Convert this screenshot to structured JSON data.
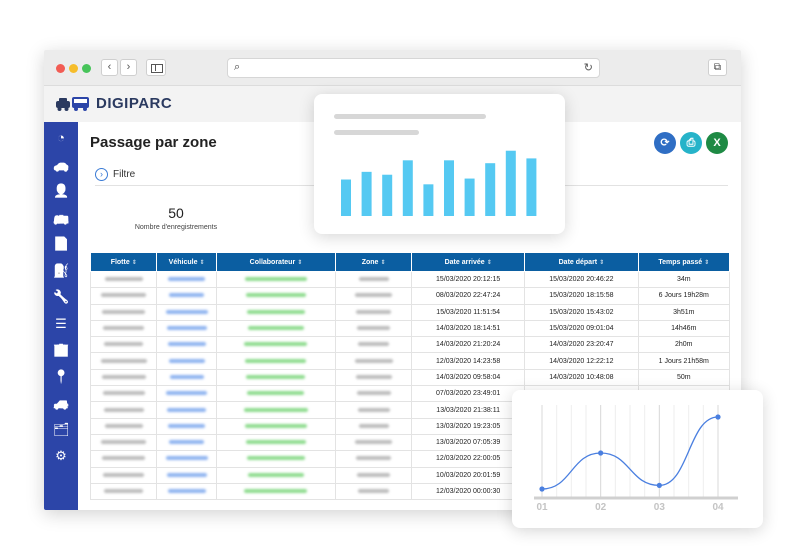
{
  "app": {
    "name": "DIGIPARC",
    "url_value": "",
    "page_title": "Passage par zone",
    "filter_label": "Filtre",
    "record_count": "50",
    "record_label": "Nombre d'enregistrements"
  },
  "colors": {
    "sidebar": "#2c45a8",
    "table_header": "#0b5ea1",
    "refresh_button": "#2f6ec4",
    "print_button": "#26b3c9",
    "excel_button": "#1e8a44",
    "bar_color": "#55c9f2",
    "line_color": "#4a7fe0"
  },
  "actions": [
    {
      "icon": "refresh-icon",
      "glyph": "⟳"
    },
    {
      "icon": "print-icon",
      "glyph": "⎙"
    },
    {
      "icon": "excel-icon",
      "glyph": "X"
    }
  ],
  "sidebar_icons": [
    {
      "icon": "dashboard-icon",
      "glyph": "◔"
    },
    {
      "icon": "car-icon",
      "glyph": "🚗"
    },
    {
      "icon": "user-icon",
      "glyph": "👤"
    },
    {
      "icon": "bus-icon",
      "glyph": "🚌"
    },
    {
      "icon": "document-icon",
      "glyph": "📄"
    },
    {
      "icon": "fuel-icon",
      "glyph": "⛽"
    },
    {
      "icon": "wrench-icon",
      "glyph": "🔧"
    },
    {
      "icon": "layers-icon",
      "glyph": "☰"
    },
    {
      "icon": "building-icon",
      "glyph": "🏢"
    },
    {
      "icon": "location-pin-icon",
      "glyph": "📍"
    },
    {
      "icon": "vehicle-front-icon",
      "glyph": "🚙"
    },
    {
      "icon": "files-icon",
      "glyph": "🗂"
    },
    {
      "icon": "gear-icon",
      "glyph": "⚙"
    }
  ],
  "table": {
    "columns": [
      "Flotte",
      "Véhicule",
      "Collaborateur",
      "Zone",
      "Date arrivée",
      "Date départ",
      "Temps passé"
    ],
    "rows": [
      [
        "15/03/2020 20:12:15",
        "15/03/2020 20:46:22",
        "34m"
      ],
      [
        "08/03/2020 22:47:24",
        "15/03/2020 18:15:58",
        "6 Jours 19h28m"
      ],
      [
        "15/03/2020 11:51:54",
        "15/03/2020 15:43:02",
        "3h51m"
      ],
      [
        "14/03/2020 18:14:51",
        "15/03/2020 09:01:04",
        "14h46m"
      ],
      [
        "14/03/2020 21:20:24",
        "14/03/2020 23:20:47",
        "2h0m"
      ],
      [
        "12/03/2020 14:23:58",
        "14/03/2020 12:22:12",
        "1 Jours 21h58m"
      ],
      [
        "14/03/2020 09:58:04",
        "14/03/2020 10:48:08",
        "50m"
      ],
      [
        "07/03/2020 23:49:01",
        "",
        ""
      ],
      [
        "13/03/2020 21:38:11",
        "",
        ""
      ],
      [
        "13/03/2020 19:23:05",
        "",
        ""
      ],
      [
        "13/03/2020 07:05:39",
        "",
        ""
      ],
      [
        "12/03/2020 22:00:05",
        "",
        ""
      ],
      [
        "10/03/2020 20:01:59",
        "",
        ""
      ],
      [
        "12/03/2020 00:00:30",
        "",
        ""
      ]
    ]
  },
  "chart_data": [
    {
      "type": "bar",
      "values": [
        38,
        46,
        43,
        58,
        33,
        58,
        39,
        55,
        68,
        60
      ],
      "ylim": [
        0,
        75
      ]
    },
    {
      "type": "line",
      "categories": [
        "01",
        "02",
        "03",
        "04"
      ],
      "values": [
        10,
        50,
        14,
        90
      ],
      "ylim": [
        0,
        100
      ],
      "grid": true
    }
  ]
}
